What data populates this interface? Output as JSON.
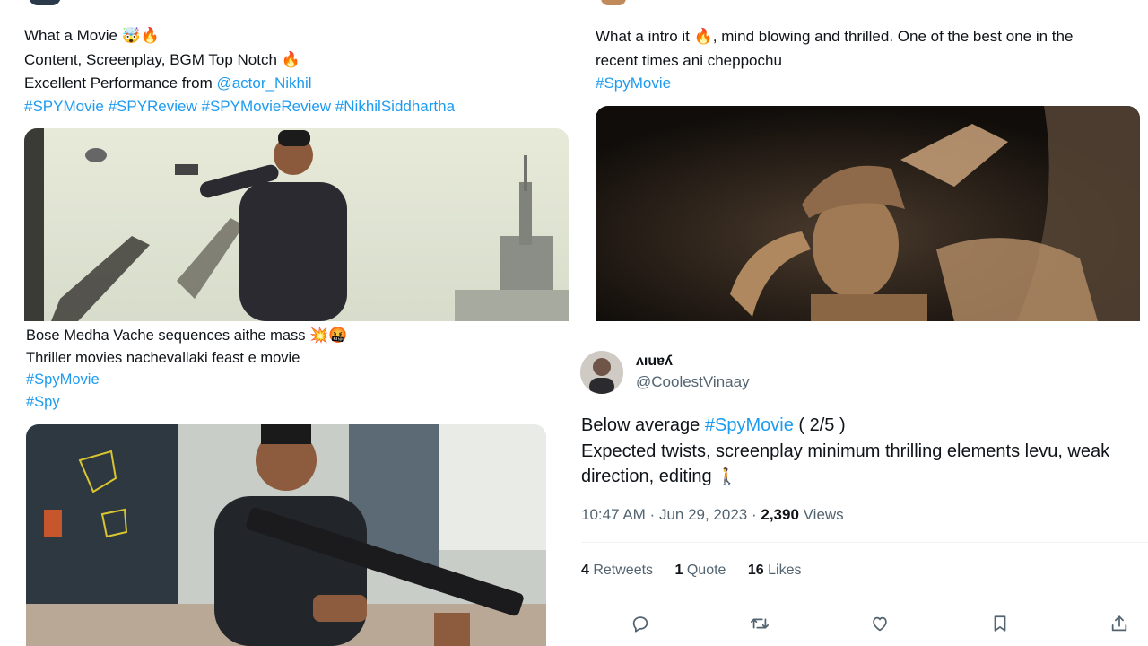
{
  "tweet1": {
    "line1": "What a Movie",
    "line1_emoji": "🤯🔥",
    "line2": "Content, Screenplay, BGM Top Notch",
    "line2_emoji": "🔥",
    "line3_prefix": "Excellent Performance from ",
    "mention": "@actor_Nikhil",
    "hashtags": [
      "#SPYMovie",
      "#SPYReview",
      "#SPYMovieReview",
      "#NikhilSiddhartha"
    ]
  },
  "tweet2": {
    "line1_prefix": "What a intro it ",
    "line1_emoji": "🔥",
    "line1_suffix": ", mind blowing and thrilled. One of the best one in the",
    "line2": "recent times ani cheppochu",
    "hashtag": "#SpyMovie"
  },
  "tweet3": {
    "line1": "Bose Medha Vache sequences aithe mass",
    "line1_emoji": "💥🤬",
    "line2": "Thriller movies nachevallaki feast e movie",
    "hashtag1": "#SpyMovie",
    "hashtag2": "#Spy"
  },
  "tweet4": {
    "display_name": "ʌıuɐʎ",
    "handle": "@CoolestVinaay",
    "line1_prefix": "Below average ",
    "hashtag": "#SpyMovie",
    "line1_suffix": " ( 2/5 )",
    "line2": "Expected twists, screenplay minimum thrilling elements levu, weak",
    "line3": "direction, editing ",
    "line3_emoji": "🚶",
    "time": "10:47 AM",
    "sep": " · ",
    "date": "Jun 29, 2023",
    "views_count": "2,390",
    "views_label": " Views",
    "retweets_count": "4",
    "retweets_label": " Retweets",
    "quotes_count": "1",
    "quotes_label": " Quote",
    "likes_count": "16",
    "likes_label": " Likes"
  },
  "icons": [
    "reply-icon",
    "retweet-icon",
    "like-icon",
    "bookmark-icon",
    "share-icon"
  ],
  "colors": {
    "link": "#1d9bf0",
    "text": "#0f1419",
    "meta": "#536471",
    "divider": "#eff3f4"
  }
}
